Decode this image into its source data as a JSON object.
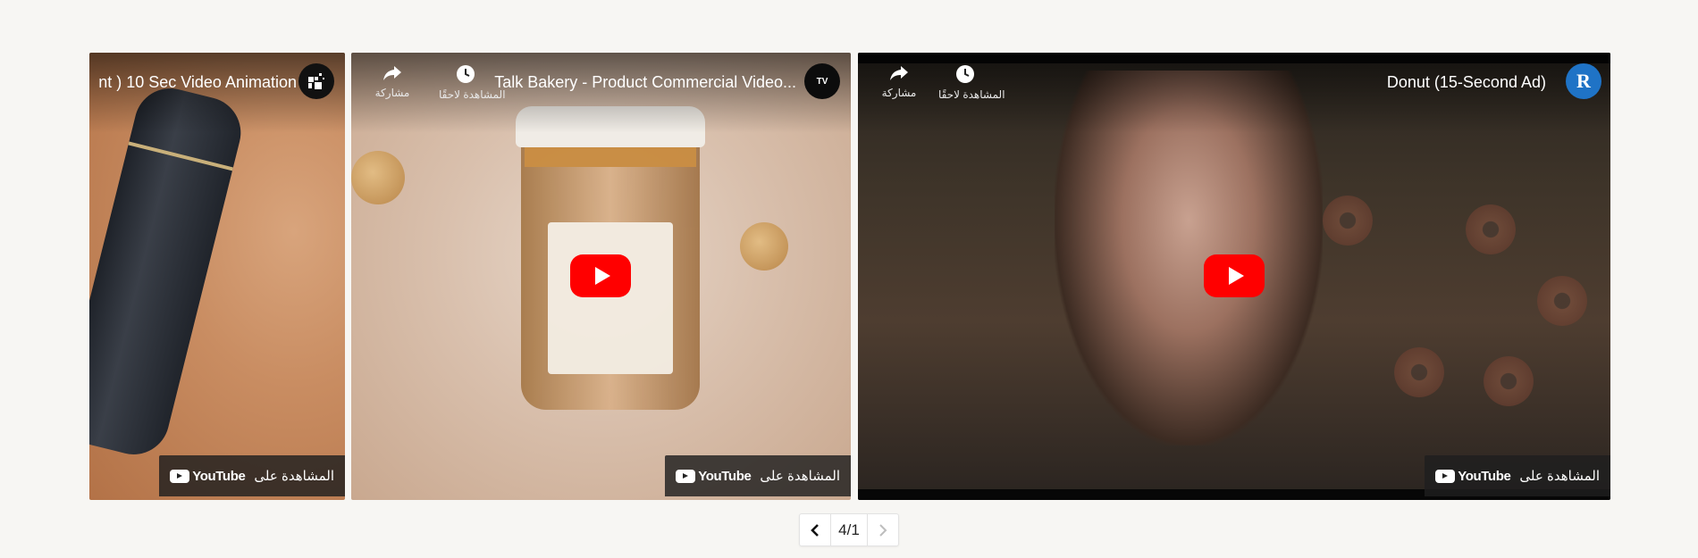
{
  "videos": [
    {
      "title": "nt ) 10 Sec Video Animation",
      "channel_icon": "grid-logo-icon",
      "watch_on": "المشاهدة على",
      "youtube_label": "YouTube"
    },
    {
      "title": "...Talk Bakery - Product Commercial Video",
      "channel_badge": "TV",
      "share_label": "مشاركة",
      "watch_later_label": "المشاهدة لاحقًا",
      "watch_on": "المشاهدة على",
      "youtube_label": "YouTube"
    },
    {
      "title": "Donut (15-Second Ad)",
      "channel_badge": "R",
      "share_label": "مشاركة",
      "watch_later_label": "المشاهدة لاحقًا",
      "watch_on": "المشاهدة على",
      "youtube_label": "YouTube"
    }
  ],
  "pager": {
    "count": "4/1",
    "prev_icon": "chevron-left-icon",
    "next_icon": "chevron-right-icon"
  },
  "colors": {
    "page_background": "#f7f6f3",
    "play_button": "#ff0000",
    "realtor_blue": "#1f73c6"
  }
}
